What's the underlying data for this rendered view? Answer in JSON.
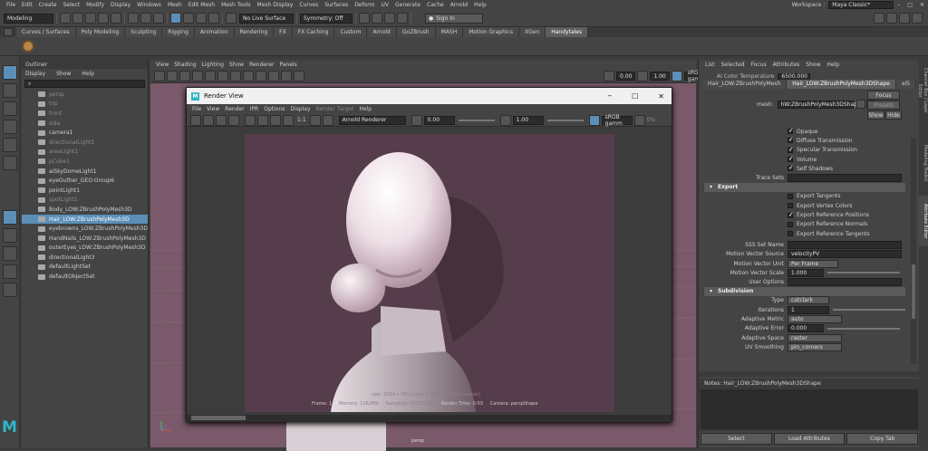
{
  "menubar": {
    "items": [
      "File",
      "Edit",
      "Create",
      "Select",
      "Modify",
      "Display",
      "Windows",
      "Mesh",
      "Edit Mesh",
      "Mesh Tools",
      "Mesh Display",
      "Curves",
      "Surfaces",
      "Deform",
      "UV",
      "Generate",
      "Cache",
      "Arnold",
      "Help"
    ],
    "workspace_label": "Workspace :",
    "workspace_value": "Maya Classic*"
  },
  "statusline": {
    "mode": "Modeling",
    "live_surface": "No Live Surface",
    "symmetry": "Symmetry: Off",
    "signin": "Sign In"
  },
  "shelf_tabs": [
    "Curves / Surfaces",
    "Poly Modeling",
    "Sculpting",
    "Rigging",
    "Animation",
    "Rendering",
    "FX",
    "FX Caching",
    "Custom",
    "Arnold",
    "GoZBrush",
    "MASH",
    "Motion Graphics",
    "XGen",
    "Handytales"
  ],
  "shelf_tabs_active": "Handytales",
  "outliner": {
    "title": "Outliner",
    "menu": [
      "Display",
      "Show",
      "Help"
    ],
    "search_placeholder": "",
    "items": [
      {
        "label": "persp",
        "dim": true
      },
      {
        "label": "top",
        "dim": true
      },
      {
        "label": "front",
        "dim": true
      },
      {
        "label": "side",
        "dim": true
      },
      {
        "label": "camera1",
        "dim": false
      },
      {
        "label": "directionalLight1",
        "dim": true
      },
      {
        "label": "areaLight1",
        "dim": true
      },
      {
        "label": "pCube1",
        "dim": true
      },
      {
        "label": "aiSkyDomeLight1",
        "dim": false
      },
      {
        "label": "eyeOuther_GEO:Group6",
        "dim": false
      },
      {
        "label": "pointLight1",
        "dim": false
      },
      {
        "label": "spotLight1",
        "dim": true
      },
      {
        "label": "Body_LOW:ZBrushPolyMesh3D",
        "dim": false
      },
      {
        "label": "Hair_LOW:ZBrushPolyMesh3D",
        "dim": false,
        "selected": true
      },
      {
        "label": "eyebrowns_LOW:ZBrushPolyMesh3D",
        "dim": false
      },
      {
        "label": "HandNails_LOW:ZBrushPolyMesh3D",
        "dim": false
      },
      {
        "label": "outerEyes_LOW:ZBrushPolyMesh3D",
        "dim": false
      },
      {
        "label": "directionalLight3",
        "dim": false
      },
      {
        "label": "defaultLightSet",
        "dim": false
      },
      {
        "label": "defaultObjectSet",
        "dim": false
      }
    ]
  },
  "viewport": {
    "menu": [
      "View",
      "Shading",
      "Lighting",
      "Show",
      "Renderer",
      "Panels"
    ],
    "field1": "0.00",
    "field2": "1.00",
    "colorspace": "sRGB gamma",
    "camera_label": "persp"
  },
  "render_view": {
    "title": "Render View",
    "menu": [
      "File",
      "View",
      "Render",
      "IPR",
      "Options",
      "Display",
      "Render Target",
      "Help"
    ],
    "ratio": "1:1",
    "renderer": "Arnold Renderer",
    "exposure": "0.00",
    "gamma": "1.00",
    "colorspace": "sRGB gamm",
    "fps_label": "0%",
    "overlay_info": "size: 1024 x 743  zoom: 0.548     (Arnold Renderer)",
    "status_frame": "Frame: 1",
    "status_memory": "Memory: 1162Mb",
    "status_sampling": "Sampling: [3/2/2/2/2]",
    "status_render_time": "Render Time: 0:03",
    "status_camera": "Camera: perspShape"
  },
  "attribute_editor": {
    "menu": [
      "List",
      "Selected",
      "Focus",
      "Attributes",
      "Show",
      "Help"
    ],
    "top_label": "AI Color Temperature",
    "top_value": "6500.000",
    "node_tabs": [
      "Hair_LOW:ZBrushPolyMesh",
      "Hair_LOW:ZBrushPolyMesh3DShape",
      "aiS"
    ],
    "mesh_label": "mesh:",
    "mesh_value": "hW:ZBrushPolyMesh3DShape",
    "focus_btn": "Focus",
    "presets_btn": "Presets",
    "show_btn": "Show",
    "hide_btn": "Hide",
    "checks_top": [
      {
        "label": "Opaque",
        "on": true
      },
      {
        "label": "Diffuse Transmission",
        "on": true
      },
      {
        "label": "Specular Transmission",
        "on": true
      },
      {
        "label": "Volume",
        "on": true
      },
      {
        "label": "Self Shadows",
        "on": true
      }
    ],
    "trace_sets_label": "Trace Sets",
    "export_section": "Export",
    "export_checks": [
      {
        "label": "Export Tangents",
        "on": false
      },
      {
        "label": "Export Vertex Colors",
        "on": false
      },
      {
        "label": "Export Reference Positions",
        "on": true
      },
      {
        "label": "Export Reference Normals",
        "on": false
      },
      {
        "label": "Export Reference Tangents",
        "on": false
      }
    ],
    "sss_label": "SSS Set Name",
    "mv_source_label": "Motion Vector Source",
    "mv_source_value": "velocityPV",
    "mv_unit_label": "Motion Vector Unit",
    "mv_unit_value": "Per Frame",
    "mv_scale_label": "Motion Vector Scale",
    "mv_scale_value": "1.000",
    "user_options_label": "User Options",
    "subdiv_section": "Subdivision",
    "type_label": "Type",
    "type_value": "catclark",
    "iterations_label": "Iterations",
    "iterations_value": "1",
    "adaptive_metric_label": "Adaptive Metric",
    "adaptive_metric_value": "auto",
    "adaptive_error_label": "Adaptive Error",
    "adaptive_error_value": "0.000",
    "adaptive_space_label": "Adaptive Space",
    "adaptive_space_value": "raster",
    "uv_smoothing_label": "UV Smoothing",
    "uv_smoothing_value": "pin_corners",
    "notes_label": "Notes: Hair_LOW:ZBrushPolyMesh3DShape",
    "bottom_buttons": [
      "Select",
      "Load Attributes",
      "Copy Tab"
    ]
  },
  "side_tabs": [
    "Channel Box / Layer Editor",
    "Modeling Toolkit",
    "Attribute Editor"
  ],
  "colors": {
    "selection": "#5c8fb8",
    "render_bg": "#563d4c",
    "viewport_bg": "#7a5a6a"
  }
}
